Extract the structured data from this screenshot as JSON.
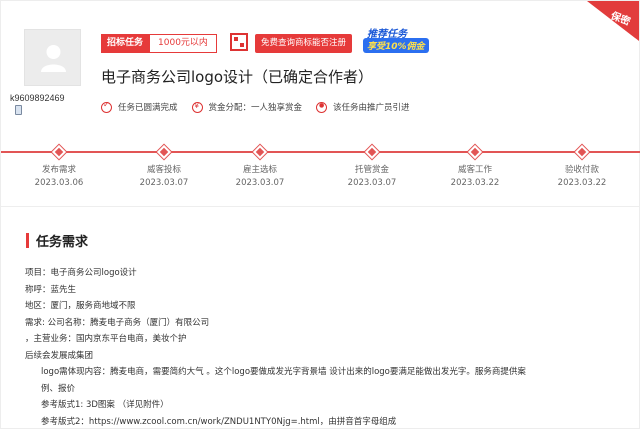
{
  "header": {
    "username": "k9609892469",
    "tag_label": "招标任务",
    "tag_price": "1000元以内",
    "check_button": "免费查询商标能否注册",
    "promo_line1": "推荐任务",
    "promo_line2": "享受10%佣金",
    "ribbon_text": "保密",
    "title": "电子商务公司logo设计（已确定合作者）",
    "meta": [
      {
        "icon": "check-circle-icon",
        "text": "任务已圆满完成"
      },
      {
        "icon": "money-icon",
        "text": "赏金分配：一人独享赏金"
      },
      {
        "icon": "referrer-icon",
        "text": "该任务由推广员引进"
      }
    ]
  },
  "timeline": {
    "accent_color": "#e25555",
    "steps": [
      {
        "label": "发布需求",
        "date": "2023.03.06"
      },
      {
        "label": "威客投标",
        "date": "2023.03.07"
      },
      {
        "label": "雇主选标",
        "date": "2023.03.07"
      },
      {
        "label": "托管赏金",
        "date": "2023.03.07"
      },
      {
        "label": "威客工作",
        "date": "2023.03.22"
      },
      {
        "label": "验收付款",
        "date": "2023.03.22"
      }
    ]
  },
  "section": {
    "title": "任务需求",
    "lines": [
      "项目：电子商务公司logo设计",
      "称呼：蓝先生",
      "地区：厦门，服务商地域不限",
      "需求: 公司名称：腾麦电子商务（厦门）有限公司",
      "，主营业务：国内京东平台电商，美妆个护",
      "后续会发展成集团",
      "logo需体现内容：腾麦电商，需要简约大气 。这个logo要做成发光字背景墙   设计出来的logo要满足能做出发光字。服务商提供案",
      "例、报价",
      "参考版式1: 3D图案 （详见附件）",
      "参考版式2：https://www.zcool.com.cn/work/ZNDU1NTY0Njg=.html，由拼音首字母组成"
    ]
  }
}
